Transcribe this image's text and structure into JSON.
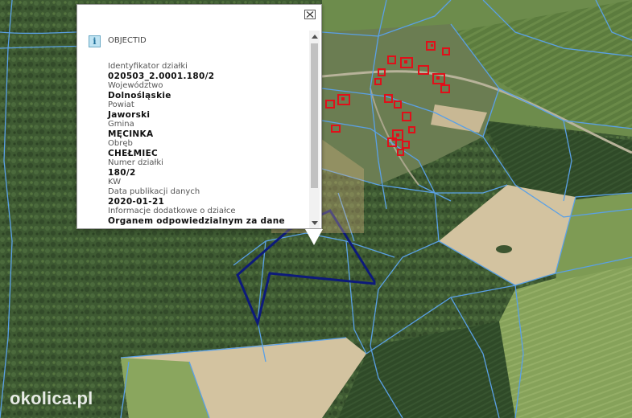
{
  "popup": {
    "title": "OBJECTID",
    "fields": [
      {
        "label": "Identyfikator działki",
        "value": "020503_2.0001.180/2"
      },
      {
        "label": "Województwo",
        "value": "Dolnośląskie"
      },
      {
        "label": "Powiat",
        "value": "Jaworski"
      },
      {
        "label": "Gmina",
        "value": "MĘCINKA"
      },
      {
        "label": "Obręb",
        "value": "CHEŁMIEC"
      },
      {
        "label": "Numer działki",
        "value": "180/2"
      },
      {
        "label": "KW",
        "value": ""
      },
      {
        "label": "Data publikacji danych",
        "value": "2020-01-21"
      },
      {
        "label": "Informacje dodatkowe o działce",
        "value": "Organem odpowiedzialnym za dane"
      }
    ]
  },
  "watermark": "okolica.pl",
  "colors": {
    "parcel_boundary": "#5aa0e6",
    "selected_parcel": "#0d1a7a",
    "buildings": "#e0101a",
    "forest": "#3c5530",
    "field_beige": "#d3c3a0"
  }
}
